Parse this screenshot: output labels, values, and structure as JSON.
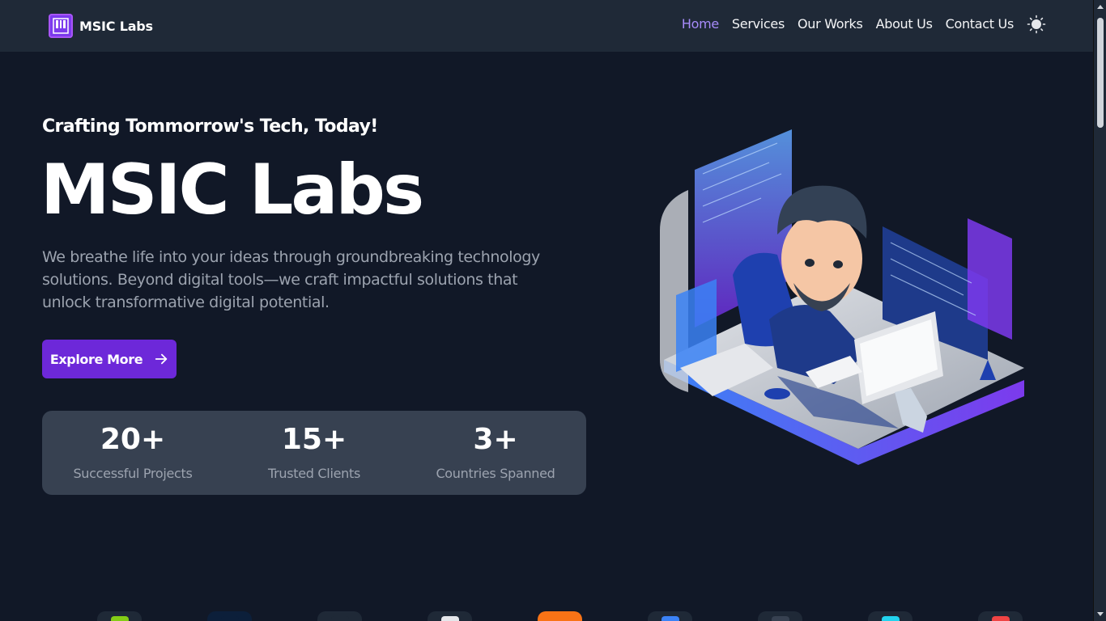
{
  "nav": {
    "brand": "MSIC Labs",
    "links": [
      {
        "label": "Home",
        "active": true
      },
      {
        "label": "Services",
        "active": false
      },
      {
        "label": "Our Works",
        "active": false
      },
      {
        "label": "About Us",
        "active": false
      },
      {
        "label": "Contact Us",
        "active": false
      }
    ],
    "theme_icon": "sun-icon"
  },
  "hero": {
    "tagline": "Crafting Tommorrow's Tech, Today!",
    "title": "MSIC Labs",
    "description": "We breathe life into your ideas through groundbreaking technology solutions. Beyond digital tools—we craft impactful solutions that unlock transformative digital potential.",
    "cta_label": "Explore More",
    "cta_icon": "arrow-right-icon"
  },
  "stats": [
    {
      "value": "20+",
      "label": "Successful Projects"
    },
    {
      "value": "15+",
      "label": "Trusted Clients"
    },
    {
      "value": "3+",
      "label": "Countries Spanned"
    }
  ],
  "colors": {
    "background": "#111827",
    "navbar": "#1f2937",
    "accent": "#6d28d9",
    "active_link": "#a78bfa",
    "stats_panel": "#374151"
  },
  "tech_logos": [
    "nodejs-icon",
    "docker-icon",
    "github-icon",
    "cloud-icon",
    "html-icon",
    "python-icon",
    "linux-icon",
    "react-icon",
    "laravel-icon"
  ]
}
